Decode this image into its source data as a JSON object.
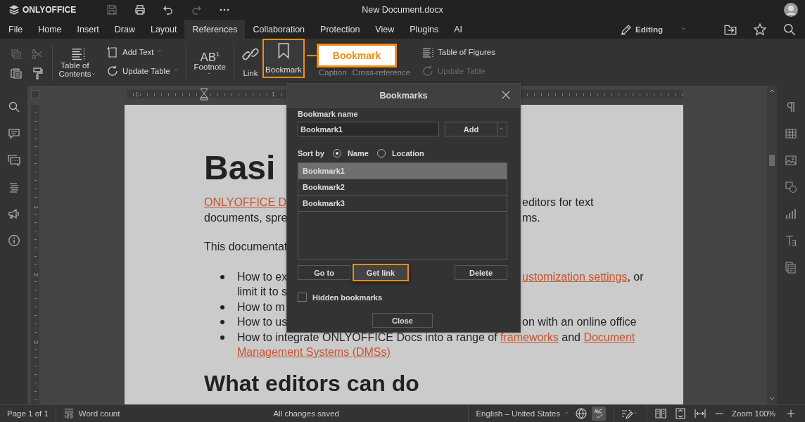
{
  "app": {
    "logo": "ONLYOFFICE",
    "title": "New Document.docx"
  },
  "quick_access": [
    {
      "kind": "save",
      "disabled": true
    },
    {
      "kind": "print",
      "disabled": false
    },
    {
      "kind": "undo",
      "disabled": false
    },
    {
      "kind": "redo",
      "disabled": true
    },
    {
      "kind": "more",
      "disabled": false
    }
  ],
  "menu_tabs": [
    {
      "label": "File",
      "selected": false
    },
    {
      "label": "Home",
      "selected": false
    },
    {
      "label": "Insert",
      "selected": false
    },
    {
      "label": "Draw",
      "selected": false
    },
    {
      "label": "Layout",
      "selected": false
    },
    {
      "label": "References",
      "selected": true
    },
    {
      "label": "Collaboration",
      "selected": false
    },
    {
      "label": "Protection",
      "selected": false
    },
    {
      "label": "View",
      "selected": false
    },
    {
      "label": "Plugins",
      "selected": false
    },
    {
      "label": "AI",
      "selected": false
    }
  ],
  "mode": {
    "label": "Editing"
  },
  "toolbar": {
    "clipboard": [
      {
        "kind": "copy",
        "disabled": true
      },
      {
        "kind": "cut",
        "disabled": true
      },
      {
        "kind": "paste",
        "disabled": false
      },
      {
        "kind": "format-painter",
        "disabled": false
      }
    ],
    "table_of_contents": {
      "label": "Table of Contents"
    },
    "add_text": {
      "label": "Add Text"
    },
    "update_table": {
      "label": "Update Table",
      "disabled": false
    },
    "footnote": {
      "icon_text": "AB$^{1}$",
      "label": "Footnote"
    },
    "link": {
      "label": "Link"
    },
    "bookmark": {
      "label": "Bookmark",
      "highlighted": true
    },
    "caption": {
      "label": "Caption"
    },
    "cross_reference": {
      "label": "Cross-reference"
    },
    "table_of_figures": {
      "label": "Table of Figures"
    },
    "update_figures_table": {
      "label": "Update Table",
      "disabled": true
    }
  },
  "callout": {
    "label": "Bookmark"
  },
  "rulers": {
    "horizontal_numbers": [
      "1",
      "1"
    ],
    "vertical_numbers": [
      "1",
      "2",
      "3"
    ]
  },
  "document": [
    {
      "kind": "title",
      "left": [
        {
          "text": "Basi",
          "link": false
        }
      ]
    },
    {
      "kind": "line",
      "left": [
        {
          "text": "ONLYOFFICE D",
          "link": true
        }
      ],
      "right": [
        {
          "text": "editors for text",
          "link": false
        }
      ]
    },
    {
      "kind": "line",
      "left": [
        {
          "text": "documents, spre",
          "link": false
        }
      ],
      "right": [
        {
          "text": "ms.",
          "link": false
        }
      ]
    },
    {
      "kind": "gap-line",
      "left": [
        {
          "text": "This documentat",
          "link": false
        }
      ]
    },
    {
      "kind": "bullet-first",
      "left": [
        {
          "text": "How to ex",
          "link": false
        }
      ],
      "right": [
        {
          "text": "ustomization settings",
          "link": true
        },
        {
          "text": ", or",
          "link": false
        }
      ]
    },
    {
      "kind": "continuation",
      "left": [
        {
          "text": "limit it to s",
          "link": false
        }
      ]
    },
    {
      "kind": "bullet",
      "left": [
        {
          "text": "How to m",
          "link": false
        }
      ]
    },
    {
      "kind": "bullet",
      "left": [
        {
          "text": "How to us",
          "link": false
        }
      ],
      "right": [
        {
          "text": "on with an online office",
          "link": false
        }
      ]
    },
    {
      "kind": "bullet",
      "left": [
        {
          "text": "How to integrate ONLYOFFICE Docs into a range of ",
          "link": false
        },
        {
          "text": "frameworks",
          "link": true
        },
        {
          "text": " and ",
          "link": false
        },
        {
          "text": "Document",
          "link": true
        }
      ]
    },
    {
      "kind": "continuation",
      "left": [
        {
          "text": "Management Systems (DMSs)",
          "link": true
        }
      ]
    },
    {
      "kind": "heading",
      "left": [
        {
          "text": "What editors can do",
          "link": false
        }
      ]
    }
  ],
  "dialog": {
    "title": "Bookmarks",
    "name_label": "Bookmark name",
    "name_value": "Bookmark1",
    "add_button": "Add",
    "sort_label": "Sort by",
    "sort_options": [
      {
        "label": "Name",
        "selected": true
      },
      {
        "label": "Location",
        "selected": false
      }
    ],
    "bookmarks": [
      {
        "label": "Bookmark1",
        "selected": true
      },
      {
        "label": "Bookmark2",
        "selected": false
      },
      {
        "label": "Bookmark3",
        "selected": false
      }
    ],
    "actions": [
      {
        "label": "Go to",
        "highlighted": false
      },
      {
        "label": "Get link",
        "highlighted": true
      },
      {
        "label": "Delete",
        "highlighted": false
      }
    ],
    "hidden_bookmarks": {
      "label": "Hidden bookmarks",
      "checked": false
    },
    "close_button": "Close"
  },
  "status_bar": {
    "page": "Page 1 of 1",
    "word_count": "Word count",
    "save_status": "All changes saved",
    "language": "English – United States",
    "spellcheck_on": true,
    "zoom": "Zoom 100%"
  }
}
